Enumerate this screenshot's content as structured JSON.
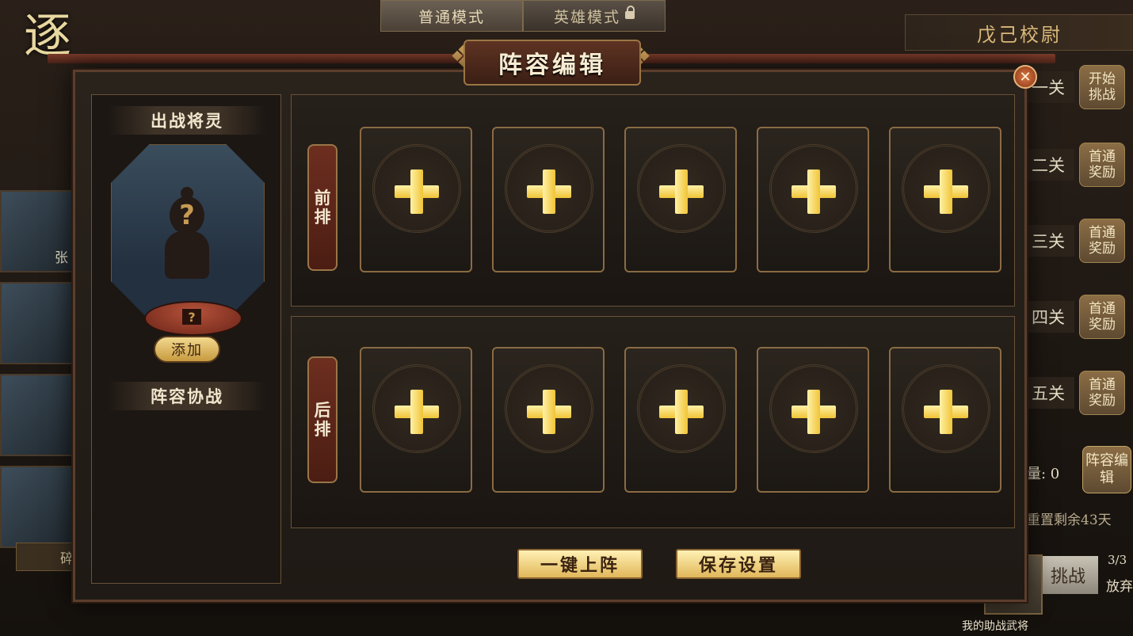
{
  "mode_tabs": [
    {
      "label": "普通模式",
      "active": true
    },
    {
      "label": "英雄模式",
      "locked": true
    }
  ],
  "background": {
    "title": "戊己校尉",
    "brand_art_text": "逐",
    "portrait_names": [
      "张"
    ],
    "left_bottom_label": "碎",
    "stages": [
      {
        "label": "一关",
        "button": "开始挑战"
      },
      {
        "label": "二关",
        "button": "首通奖励"
      },
      {
        "label": "三关",
        "button": "首通奖励"
      },
      {
        "label": "四关",
        "button": "首通奖励"
      },
      {
        "label": "五关",
        "button": "首通奖励"
      }
    ],
    "count_label": "量: 0",
    "edit_button": "阵容编辑",
    "reset_text": "重置剩余43天",
    "challenge_label": "挑战",
    "count_fraction": "3/3",
    "abandon_label": "放弃",
    "helper_label": "我的助战武将"
  },
  "modal": {
    "title": "阵容编辑",
    "close_symbol": "✕",
    "left_panel": {
      "heading_general": "出战将灵",
      "question_symbol": "?",
      "add_button": "添加",
      "heading_assist": "阵容协战"
    },
    "rows": [
      {
        "label": "前排",
        "slots": 5
      },
      {
        "label": "后排",
        "slots": 5
      }
    ],
    "buttons": {
      "auto_deploy": "一键上阵",
      "save": "保存设置"
    }
  },
  "colors": {
    "accent_gold": "#f0c437",
    "frame_brown": "#8a6b43",
    "banner_red": "#6d2e1f"
  }
}
